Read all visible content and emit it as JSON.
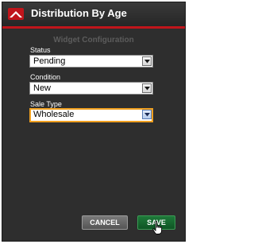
{
  "header": {
    "title": "Distribution By Age"
  },
  "config": {
    "section_title": "Widget Configuration",
    "fields": [
      {
        "label": "Status",
        "value": "Pending"
      },
      {
        "label": "Condition",
        "value": "New"
      },
      {
        "label": "Sale Type",
        "value": "Wholesale"
      }
    ]
  },
  "buttons": {
    "cancel": "CANCEL",
    "save": "SAVE"
  },
  "icons": {
    "logo": "brand-logo-icon",
    "dropdown": "chevron-down-icon",
    "cursor": "hand-pointer-icon"
  },
  "colors": {
    "accent_red": "#c0151b",
    "panel_bg": "#2e2e2e",
    "focus_orange": "#f0a020",
    "save_green": "#1a6a32"
  }
}
